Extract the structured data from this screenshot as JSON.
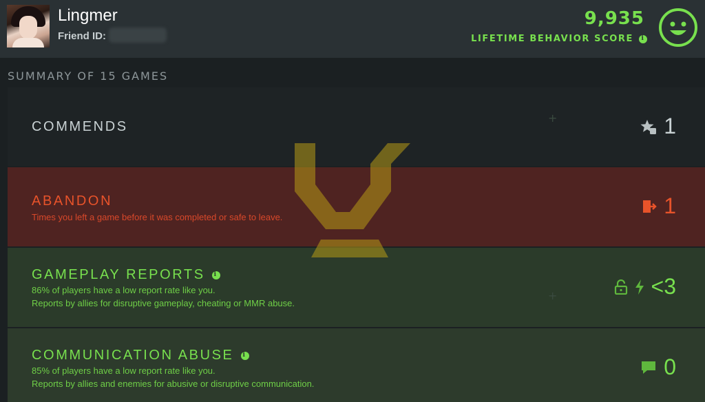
{
  "profile": {
    "username": "Lingmer",
    "friend_id_label": "Friend ID:",
    "score": "9,935",
    "score_label": "LIFETIME BEHAVIOR SCORE"
  },
  "summary": {
    "title": "SUMMARY OF 15 GAMES"
  },
  "rows": {
    "commends": {
      "title": "COMMENDS",
      "value": "1",
      "icon": "star-thumb-icon"
    },
    "abandon": {
      "title": "ABANDON",
      "desc": "Times you left a game before it was completed or safe to leave.",
      "value": "1",
      "icon": "exit-door-icon"
    },
    "gameplay": {
      "title": "GAMEPLAY REPORTS",
      "line1": "86% of players have a low report rate like you.",
      "line2": "Reports by allies for disruptive gameplay, cheating or MMR abuse.",
      "value": "<3",
      "icon": "lock-lightning-icon"
    },
    "communication": {
      "title": "COMMUNICATION ABUSE",
      "line1": "85% of players have a low report rate like you.",
      "line2": "Reports by allies and enemies for abusive or disruptive communication.",
      "value": "0",
      "icon": "chat-bubble-icon"
    }
  },
  "colors": {
    "accent_green": "#78e04e",
    "abandon_red": "#e8532a",
    "neutral": "#c9d2d4"
  }
}
